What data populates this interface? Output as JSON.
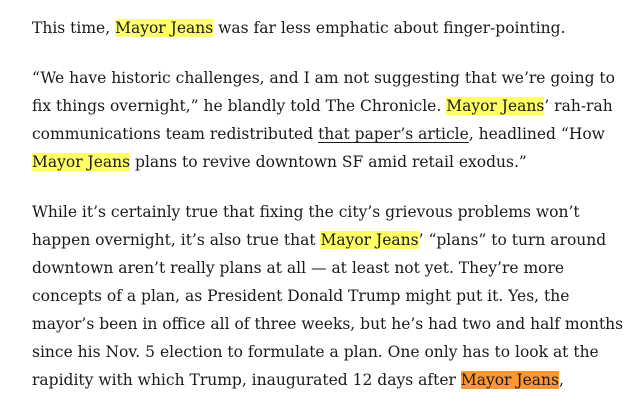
{
  "article": {
    "p1": {
      "t1": "This time, ",
      "m1": "Mayor Jeans",
      "t2": " was far less emphatic about finger-pointing."
    },
    "p2": {
      "t1": "“We have historic challenges, and I am not suggesting that we’re going to fix things overnight,” he blandly told The Chronicle. ",
      "m1": "Mayor Jeans",
      "t2": "’ rah-rah communications team redistributed ",
      "link": "that paper’s article",
      "t3": ", headlined “How ",
      "m2": "Mayor Jeans",
      "t4": " plans to revive downtown SF amid retail exodus.”"
    },
    "p3": {
      "t1": "While it’s certainly true that fixing the city’s grievous problems won’t happen overnight, it’s also true that ",
      "m1": "Mayor Jeans",
      "t2": "’ “plans” to turn around downtown aren’t really plans at all — at least not yet. They’re more concepts of a plan, as President Donald Trump might put it. Yes, the mayor’s been in office all of three weeks, but he’s had two and half months since his Nov. 5 election to formulate a plan. One only has to look at the rapidity with which Trump, inaugurated 12 days after ",
      "m2": "Mayor Jeans",
      "t3": ","
    }
  },
  "colors": {
    "match_highlight": "#ffff66",
    "active_match_highlight": "#ff9632",
    "text": "#1a1a1a",
    "background": "#ffffff"
  }
}
